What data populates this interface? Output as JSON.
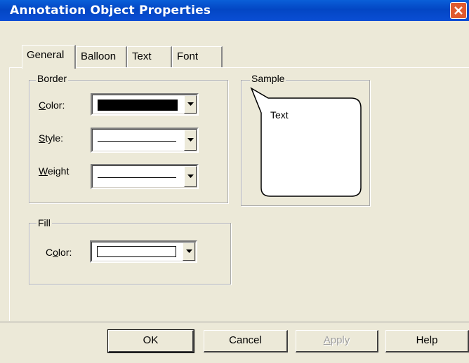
{
  "window": {
    "title": "Annotation Object Properties",
    "close_icon": "close-icon"
  },
  "tabs": [
    {
      "label": "General",
      "active": true
    },
    {
      "label": "Balloon",
      "active": false
    },
    {
      "label": "Text",
      "active": false
    },
    {
      "label": "Font",
      "active": false
    }
  ],
  "border": {
    "legend": "Border",
    "color_label": "Color:",
    "color_value": "#000000",
    "style_label": "Style:",
    "weight_label": "Weight"
  },
  "sample": {
    "legend": "Sample",
    "text": "Text"
  },
  "fill": {
    "legend": "Fill",
    "color_label": "Color:",
    "color_value": "#ffffff"
  },
  "buttons": {
    "ok": "OK",
    "cancel": "Cancel",
    "apply": "Apply",
    "help": "Help"
  }
}
